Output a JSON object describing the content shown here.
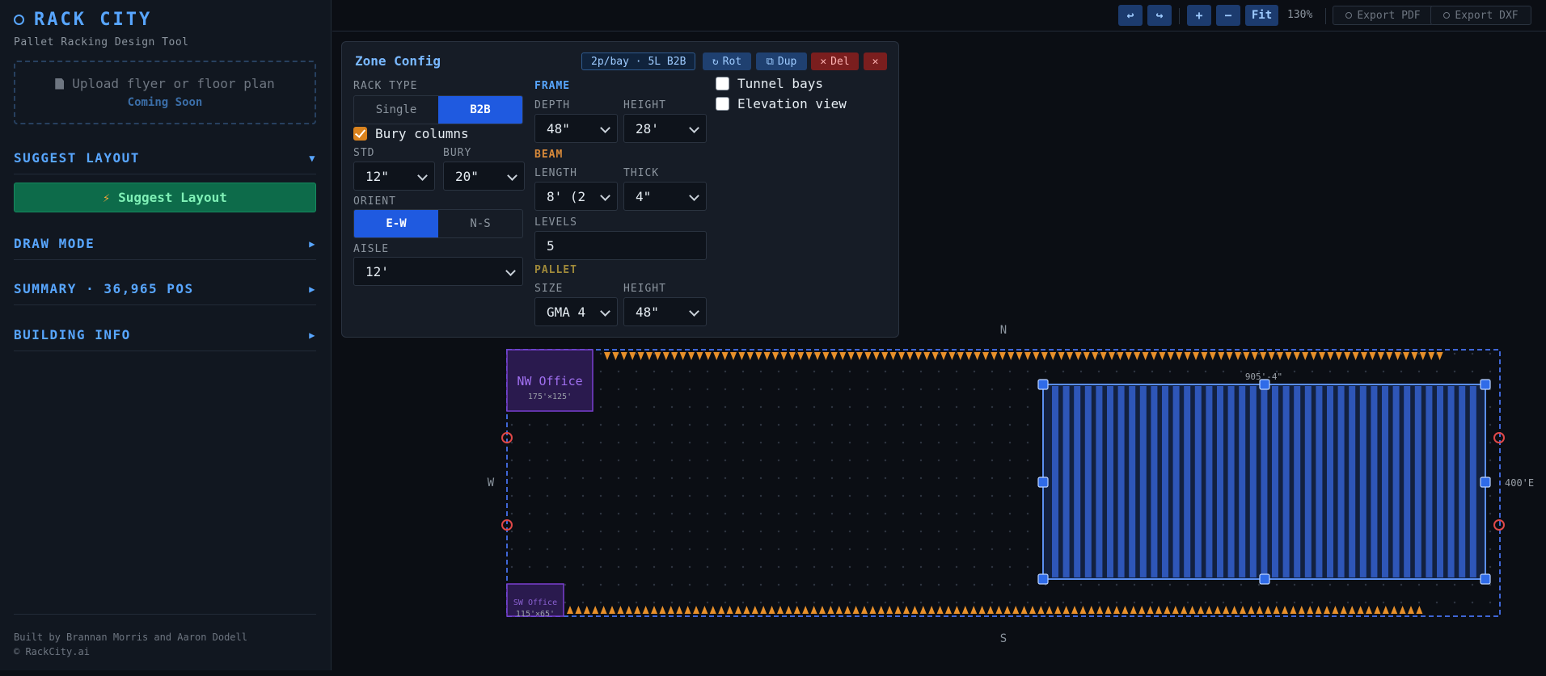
{
  "app": {
    "title": "RACK CITY",
    "tagline": "Pallet Racking Design Tool"
  },
  "upload": {
    "label": "Upload flyer or floor plan",
    "status": "Coming Soon"
  },
  "sidebar": {
    "suggest_section": "SUGGEST LAYOUT",
    "suggest_button": "Suggest Layout",
    "draw_mode": "DRAW MODE",
    "summary": "SUMMARY · 36,965 POS",
    "building_info": "BUILDING INFO",
    "credits": [
      "Built by Brannan Morris and Aaron Dodell",
      "© RackCity.ai"
    ]
  },
  "toolbar": {
    "undo": "↩",
    "redo": "↪",
    "zoom_in": "+",
    "zoom_out": "−",
    "fit": "Fit",
    "zoom_level": "130%",
    "export_pdf": "Export PDF",
    "export_dxf": "Export DXF"
  },
  "zone": {
    "title": "Zone Config",
    "badge": "2p/bay · 5L B2B",
    "rot": "Rot",
    "dup": "Dup",
    "del": "Del",
    "rack_type_label": "RACK TYPE",
    "rack_types": [
      "Single",
      "B2B"
    ],
    "rack_type_selected": "B2B",
    "bury_columns": "Bury columns",
    "bury_columns_checked": true,
    "std_label": "STD",
    "std_value": "12\"",
    "bury_label": "BURY",
    "bury_value": "20\"",
    "orient_label": "ORIENT",
    "orients": [
      "E-W",
      "N-S"
    ],
    "orient_selected": "E-W",
    "aisle_label": "AISLE",
    "aisle_value": "12'",
    "frame_label": "FRAME",
    "depth_label": "DEPTH",
    "depth_value": "48\"",
    "height_label": "HEIGHT",
    "height_value": "28'",
    "beam_label": "BEAM",
    "length_label": "LENGTH",
    "length_value": "8' (2",
    "thick_label": "THICK",
    "thick_value": "4\"",
    "levels_label": "LEVELS",
    "levels_value": "5",
    "pallet_label": "PALLET",
    "size_label": "SIZE",
    "size_value": "GMA 4",
    "pallet_height_label": "HEIGHT",
    "pallet_height_value": "48\"",
    "tunnel_bays": "Tunnel bays",
    "tunnel_bays_checked": false,
    "elevation_view": "Elevation view",
    "elevation_view_checked": false
  },
  "plan": {
    "north": "N",
    "south": "S",
    "west": "W",
    "east_dim": "400'E",
    "rack_dim": "905'-4\"",
    "nw_office": "NW Office",
    "nw_office_dim": "175'×125'",
    "sw_office": "SW Office",
    "sw_office_dim": "115'×65'"
  },
  "colors": {
    "accent": "#58a6ff",
    "primary_button": "#1f5ae0",
    "suggest_green": "#0d6b4a",
    "danger": "#7a1e1e",
    "dock_orange": "#e8902a",
    "office_purple": "#7a3fd0"
  }
}
